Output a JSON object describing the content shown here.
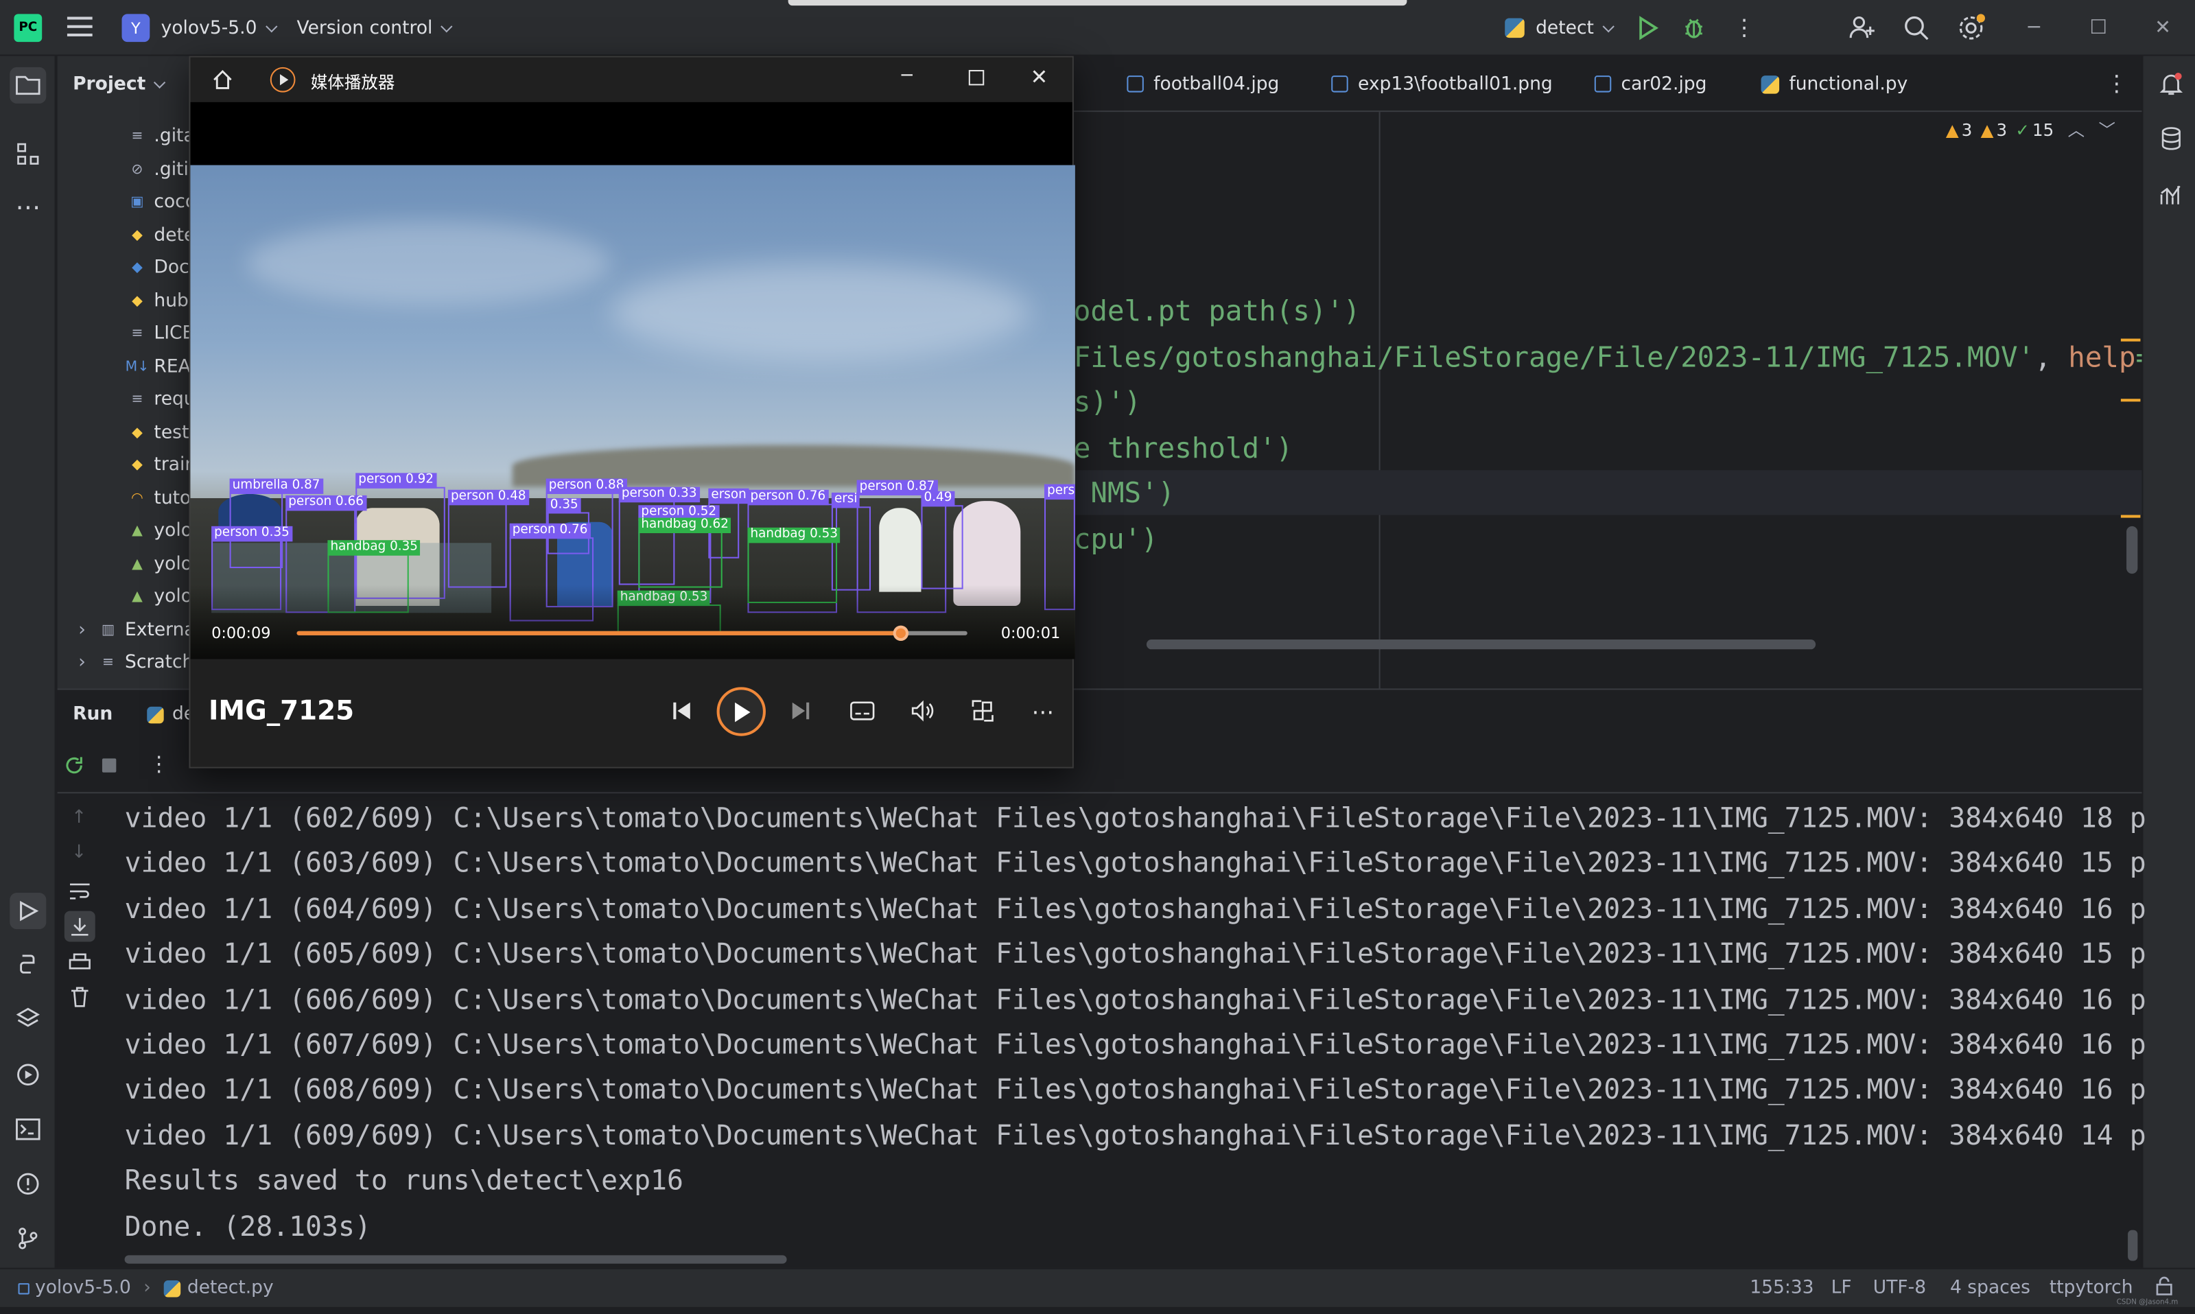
{
  "topbar": {
    "project_badge": "Y",
    "project_name": "yolov5-5.0",
    "vcs": "Version control",
    "run_config": "detect"
  },
  "project_panel": {
    "title": "Project",
    "items": [
      ".gita",
      ".gitig",
      "coco",
      "dete",
      "Doc",
      "hubc",
      "LICE",
      "REA",
      "requ",
      "test.",
      "train",
      "tuto",
      "yolo",
      "yolo",
      "yolo",
      "Externa",
      "Scratch"
    ]
  },
  "editor": {
    "tabs": [
      "football04.jpg",
      "exp13\\football01.png",
      "car02.jpg",
      "functional.py"
    ],
    "inspections": {
      "warn1": "3",
      "warn2": "3",
      "ok": "15"
    },
    "lines": [
      {
        "parts": [
          {
            "t": "odel.pt path(s)')",
            "c": "str"
          }
        ]
      },
      {
        "parts": [
          {
            "t": "Files/gotoshanghai/FileStorage/File/2023-11/IMG_7125.MOV'",
            "c": "str"
          },
          {
            "t": ", ",
            "c": ""
          },
          {
            "t": "help",
            "c": "kw"
          },
          {
            "t": "='",
            "c": "str"
          }
        ]
      },
      {
        "parts": [
          {
            "t": "s)')",
            "c": "str"
          }
        ]
      },
      {
        "parts": [
          {
            "t": "e threshold')",
            "c": "str"
          }
        ]
      },
      {
        "parts": [
          {
            "t": " NMS')",
            "c": "str"
          }
        ]
      },
      {
        "parts": [
          {
            "t": "cpu')",
            "c": "str"
          }
        ]
      }
    ]
  },
  "run_panel": {
    "tab_run": "Run",
    "tab_config": "de",
    "output": [
      "video 1/1 (602/609) C:\\Users\\tomato\\Documents\\WeChat Files\\gotoshanghai\\FileStorage\\File\\2023-11\\IMG_7125.MOV: 384x640 18 p",
      "video 1/1 (603/609) C:\\Users\\tomato\\Documents\\WeChat Files\\gotoshanghai\\FileStorage\\File\\2023-11\\IMG_7125.MOV: 384x640 15 p",
      "video 1/1 (604/609) C:\\Users\\tomato\\Documents\\WeChat Files\\gotoshanghai\\FileStorage\\File\\2023-11\\IMG_7125.MOV: 384x640 16 p",
      "video 1/1 (605/609) C:\\Users\\tomato\\Documents\\WeChat Files\\gotoshanghai\\FileStorage\\File\\2023-11\\IMG_7125.MOV: 384x640 15 p",
      "video 1/1 (606/609) C:\\Users\\tomato\\Documents\\WeChat Files\\gotoshanghai\\FileStorage\\File\\2023-11\\IMG_7125.MOV: 384x640 16 p",
      "video 1/1 (607/609) C:\\Users\\tomato\\Documents\\WeChat Files\\gotoshanghai\\FileStorage\\File\\2023-11\\IMG_7125.MOV: 384x640 16 p",
      "video 1/1 (608/609) C:\\Users\\tomato\\Documents\\WeChat Files\\gotoshanghai\\FileStorage\\File\\2023-11\\IMG_7125.MOV: 384x640 16 p",
      "video 1/1 (609/609) C:\\Users\\tomato\\Documents\\WeChat Files\\gotoshanghai\\FileStorage\\File\\2023-11\\IMG_7125.MOV: 384x640 14 p",
      "Results saved to runs\\detect\\exp16",
      "Done. (28.103s)"
    ]
  },
  "status_bar": {
    "project": "yolov5-5.0",
    "file": "detect.py",
    "position": "155:33",
    "line_sep": "LF",
    "encoding": "UTF-8",
    "indent": "4 spaces",
    "interpreter": "ttpytorch",
    "watermark": "CSDN @Jason4.m"
  },
  "media_player": {
    "title": "媒体播放器",
    "time_elapsed": "0:00:09",
    "time_remaining": "0:00:01",
    "progress_fraction": 0.9,
    "video_name": "IMG_7125",
    "detections": [
      {
        "label": "umbrella 0.87",
        "g": false
      },
      {
        "label": "person 0.92",
        "g": false
      },
      {
        "label": "person 0.66",
        "g": false
      },
      {
        "label": "person 0.88",
        "g": false
      },
      {
        "label": "person 0.48",
        "g": false
      },
      {
        "label": "0.35",
        "g": false
      },
      {
        "label": "person 0.33",
        "g": false
      },
      {
        "label": "erson",
        "g": false
      },
      {
        "label": "person 0.76",
        "g": false
      },
      {
        "label": "ersi",
        "g": false
      },
      {
        "label": "person 0.87",
        "g": false
      },
      {
        "label": "0.49",
        "g": false
      },
      {
        "label": "pers",
        "g": false
      },
      {
        "label": "person 0.52",
        "g": false
      },
      {
        "label": "handbag 0.62",
        "g": true
      },
      {
        "label": "person 0.35",
        "g": false
      },
      {
        "label": "handbag 0.35",
        "g": true
      },
      {
        "label": "person 0.76",
        "g": false
      },
      {
        "label": "handbag 0.53",
        "g": true
      },
      {
        "label": "handbag 0.53",
        "g": true
      }
    ]
  },
  "colors": {
    "accent_orange": "#f0883a",
    "detection_purple": "#7b5cf0",
    "detection_green": "#2fb24a",
    "string_green": "#6aab73",
    "keyword_orange": "#cf8e6d"
  }
}
